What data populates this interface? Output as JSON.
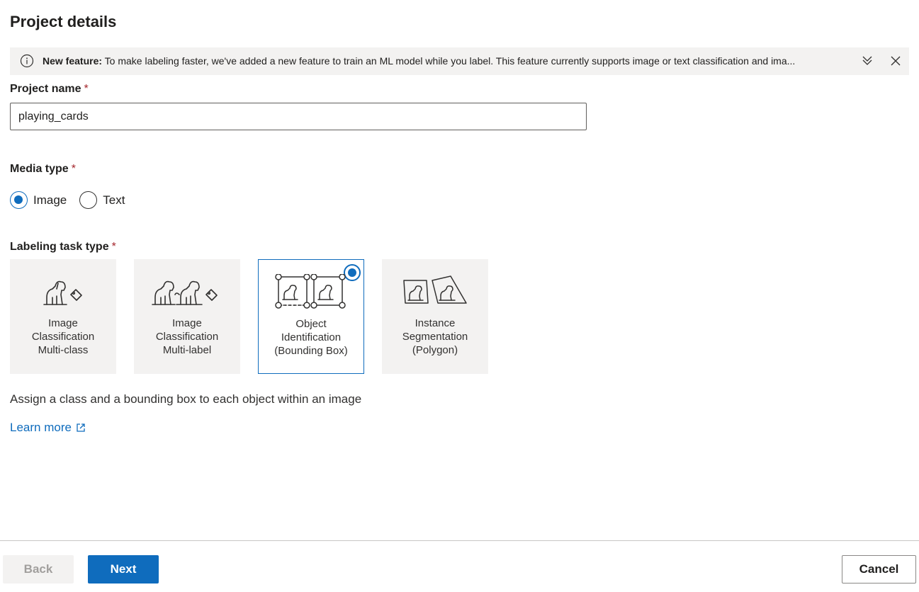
{
  "page": {
    "title": "Project details"
  },
  "banner": {
    "label": "New feature:",
    "text": " To make labeling faster, we've added a new feature to train an ML model while you label. This feature currently supports image or text classification and ima...",
    "icon": "info-icon",
    "expand_icon": "chevron-double-down-icon",
    "close_icon": "close-icon"
  },
  "project_name": {
    "label": "Project name",
    "required_mark": "*",
    "value": "playing_cards"
  },
  "media_type": {
    "label": "Media type",
    "required_mark": "*",
    "options": [
      {
        "label": "Image",
        "selected": true
      },
      {
        "label": "Text",
        "selected": false
      }
    ]
  },
  "task_type": {
    "label": "Labeling task type",
    "required_mark": "*",
    "tiles": [
      {
        "lines": [
          "Image",
          "Classification",
          "Multi-class"
        ],
        "icon": "dog-tag-icon",
        "selected": false
      },
      {
        "lines": [
          "Image",
          "Classification",
          "Multi-label"
        ],
        "icon": "dogs-tag-icon",
        "selected": false
      },
      {
        "lines": [
          "Object",
          "Identification",
          "(Bounding Box)"
        ],
        "icon": "bounding-box-icon",
        "selected": true
      },
      {
        "lines": [
          "Instance",
          "Segmentation",
          "(Polygon)"
        ],
        "icon": "polygon-icon",
        "selected": false
      }
    ],
    "description": "Assign a class and a bounding box to each object within an image",
    "learn_more": "Learn more"
  },
  "footer": {
    "back": "Back",
    "next": "Next",
    "cancel": "Cancel"
  },
  "colors": {
    "accent": "#0f6cbd",
    "required": "#a4262c",
    "banner_bg": "#f3f2f1"
  }
}
